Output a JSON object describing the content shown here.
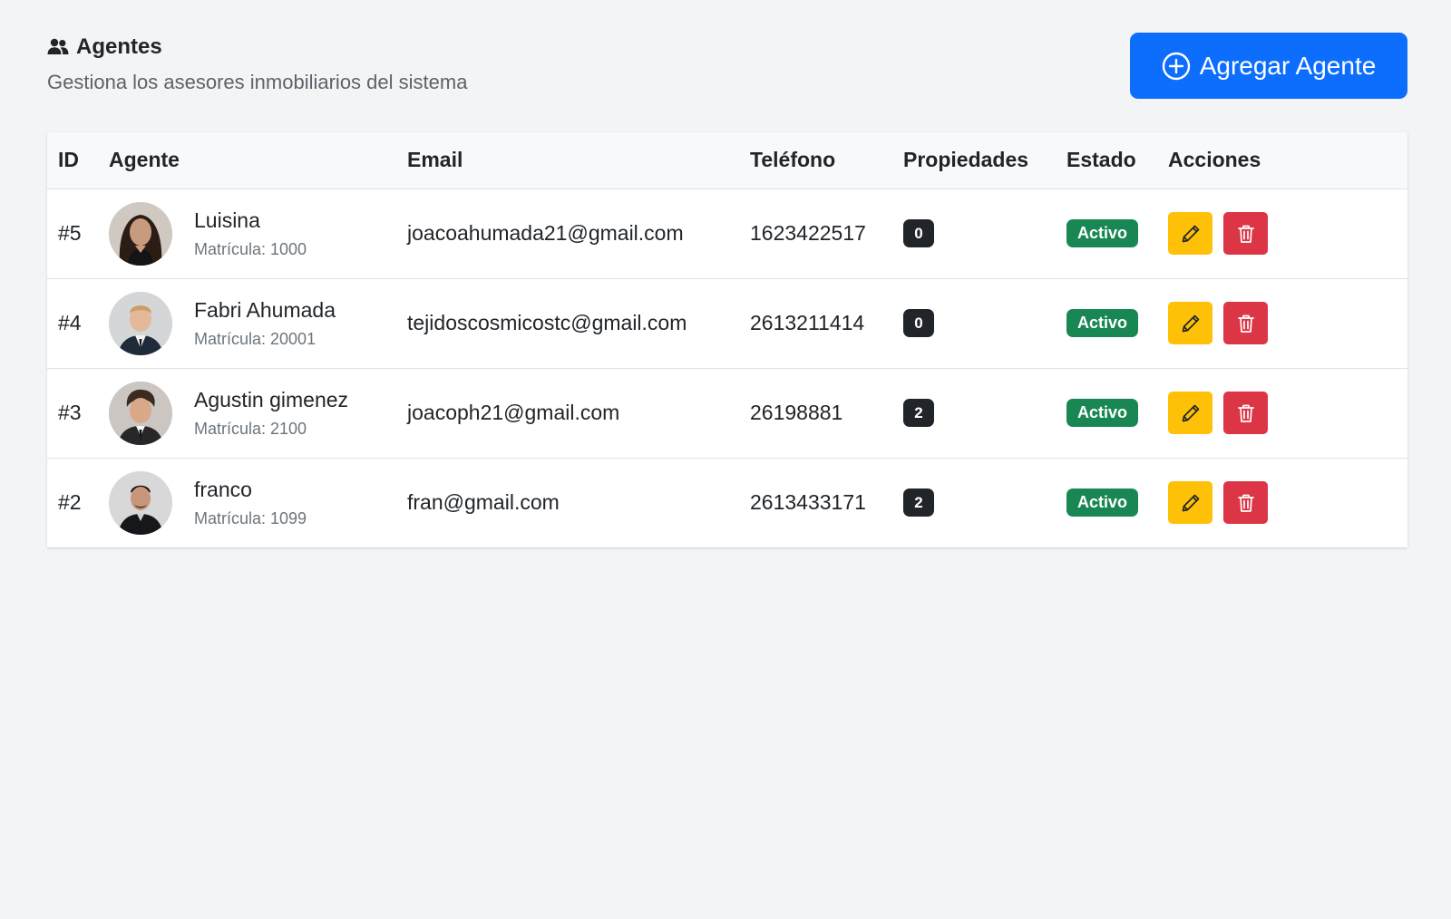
{
  "header": {
    "title": "Agentes",
    "subtitle": "Gestiona los asesores inmobiliarios del sistema",
    "add_button_label": "Agregar Agente"
  },
  "table": {
    "columns": [
      "ID",
      "Agente",
      "Email",
      "Teléfono",
      "Propiedades",
      "Estado",
      "Acciones"
    ],
    "rows": [
      {
        "id": "#5",
        "name": "Luisina",
        "matricula": "Matrícula: 1000",
        "email": "joacoahumada21@gmail.com",
        "phone": "1623422517",
        "properties": "0",
        "status": "Activo"
      },
      {
        "id": "#4",
        "name": "Fabri Ahumada",
        "matricula": "Matrícula: 20001",
        "email": "tejidoscosmicostc@gmail.com",
        "phone": "2613211414",
        "properties": "0",
        "status": "Activo"
      },
      {
        "id": "#3",
        "name": "Agustin gimenez",
        "matricula": "Matrícula: 2100",
        "email": "joacoph21@gmail.com",
        "phone": "26198881",
        "properties": "2",
        "status": "Activo"
      },
      {
        "id": "#2",
        "name": "franco",
        "matricula": "Matrícula: 1099",
        "email": "fran@gmail.com",
        "phone": "2613433171",
        "properties": "2",
        "status": "Activo"
      }
    ]
  },
  "colors": {
    "primary": "#0d6efd",
    "success": "#198754",
    "warning": "#ffc107",
    "danger": "#dc3545",
    "dark": "#212529",
    "background": "#f3f4f6"
  },
  "icons": {
    "title": "people-icon",
    "add": "plus-circle-icon",
    "edit": "pencil-icon",
    "delete": "trash-icon"
  }
}
